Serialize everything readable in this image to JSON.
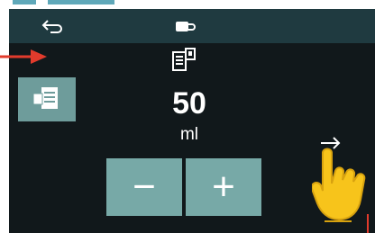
{
  "header": {
    "back_icon": "back-arrow-icon",
    "cup_icon": "coffee-cup-icon"
  },
  "recipe": {
    "icon": "recipe-card-icon",
    "button_icon": "recipe-select-icon"
  },
  "volume": {
    "value": "50",
    "unit": "ml"
  },
  "stepper": {
    "minus_label": "−",
    "plus_label": "+"
  },
  "navigation": {
    "next_label": "→"
  },
  "colors": {
    "screen_bg": "#11181b",
    "topbar_bg": "#1f3a40",
    "button_teal": "#77a9a7",
    "accent_red": "#e23b2c",
    "hand_yellow": "#f7c41b"
  }
}
